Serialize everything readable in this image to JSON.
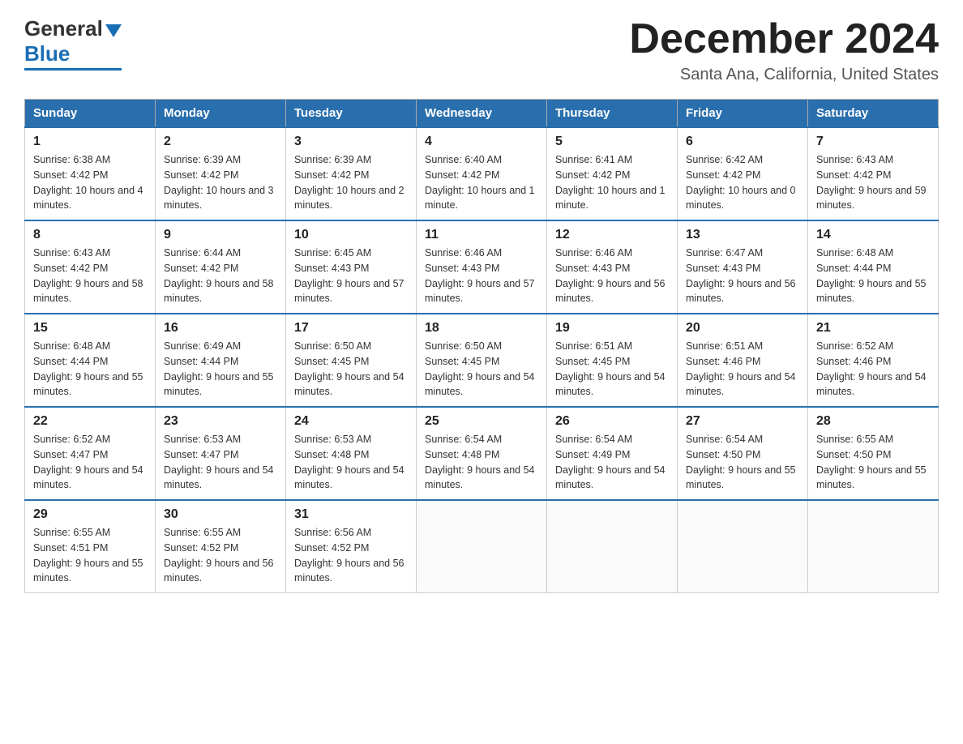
{
  "header": {
    "logo": {
      "text1": "General",
      "text2": "Blue"
    },
    "title": "December 2024",
    "location": "Santa Ana, California, United States"
  },
  "weekdays": [
    "Sunday",
    "Monday",
    "Tuesday",
    "Wednesday",
    "Thursday",
    "Friday",
    "Saturday"
  ],
  "weeks": [
    [
      {
        "day": "1",
        "sunrise": "6:38 AM",
        "sunset": "4:42 PM",
        "daylight": "10 hours and 4 minutes."
      },
      {
        "day": "2",
        "sunrise": "6:39 AM",
        "sunset": "4:42 PM",
        "daylight": "10 hours and 3 minutes."
      },
      {
        "day": "3",
        "sunrise": "6:39 AM",
        "sunset": "4:42 PM",
        "daylight": "10 hours and 2 minutes."
      },
      {
        "day": "4",
        "sunrise": "6:40 AM",
        "sunset": "4:42 PM",
        "daylight": "10 hours and 1 minute."
      },
      {
        "day": "5",
        "sunrise": "6:41 AM",
        "sunset": "4:42 PM",
        "daylight": "10 hours and 1 minute."
      },
      {
        "day": "6",
        "sunrise": "6:42 AM",
        "sunset": "4:42 PM",
        "daylight": "10 hours and 0 minutes."
      },
      {
        "day": "7",
        "sunrise": "6:43 AM",
        "sunset": "4:42 PM",
        "daylight": "9 hours and 59 minutes."
      }
    ],
    [
      {
        "day": "8",
        "sunrise": "6:43 AM",
        "sunset": "4:42 PM",
        "daylight": "9 hours and 58 minutes."
      },
      {
        "day": "9",
        "sunrise": "6:44 AM",
        "sunset": "4:42 PM",
        "daylight": "9 hours and 58 minutes."
      },
      {
        "day": "10",
        "sunrise": "6:45 AM",
        "sunset": "4:43 PM",
        "daylight": "9 hours and 57 minutes."
      },
      {
        "day": "11",
        "sunrise": "6:46 AM",
        "sunset": "4:43 PM",
        "daylight": "9 hours and 57 minutes."
      },
      {
        "day": "12",
        "sunrise": "6:46 AM",
        "sunset": "4:43 PM",
        "daylight": "9 hours and 56 minutes."
      },
      {
        "day": "13",
        "sunrise": "6:47 AM",
        "sunset": "4:43 PM",
        "daylight": "9 hours and 56 minutes."
      },
      {
        "day": "14",
        "sunrise": "6:48 AM",
        "sunset": "4:44 PM",
        "daylight": "9 hours and 55 minutes."
      }
    ],
    [
      {
        "day": "15",
        "sunrise": "6:48 AM",
        "sunset": "4:44 PM",
        "daylight": "9 hours and 55 minutes."
      },
      {
        "day": "16",
        "sunrise": "6:49 AM",
        "sunset": "4:44 PM",
        "daylight": "9 hours and 55 minutes."
      },
      {
        "day": "17",
        "sunrise": "6:50 AM",
        "sunset": "4:45 PM",
        "daylight": "9 hours and 54 minutes."
      },
      {
        "day": "18",
        "sunrise": "6:50 AM",
        "sunset": "4:45 PM",
        "daylight": "9 hours and 54 minutes."
      },
      {
        "day": "19",
        "sunrise": "6:51 AM",
        "sunset": "4:45 PM",
        "daylight": "9 hours and 54 minutes."
      },
      {
        "day": "20",
        "sunrise": "6:51 AM",
        "sunset": "4:46 PM",
        "daylight": "9 hours and 54 minutes."
      },
      {
        "day": "21",
        "sunrise": "6:52 AM",
        "sunset": "4:46 PM",
        "daylight": "9 hours and 54 minutes."
      }
    ],
    [
      {
        "day": "22",
        "sunrise": "6:52 AM",
        "sunset": "4:47 PM",
        "daylight": "9 hours and 54 minutes."
      },
      {
        "day": "23",
        "sunrise": "6:53 AM",
        "sunset": "4:47 PM",
        "daylight": "9 hours and 54 minutes."
      },
      {
        "day": "24",
        "sunrise": "6:53 AM",
        "sunset": "4:48 PM",
        "daylight": "9 hours and 54 minutes."
      },
      {
        "day": "25",
        "sunrise": "6:54 AM",
        "sunset": "4:48 PM",
        "daylight": "9 hours and 54 minutes."
      },
      {
        "day": "26",
        "sunrise": "6:54 AM",
        "sunset": "4:49 PM",
        "daylight": "9 hours and 54 minutes."
      },
      {
        "day": "27",
        "sunrise": "6:54 AM",
        "sunset": "4:50 PM",
        "daylight": "9 hours and 55 minutes."
      },
      {
        "day": "28",
        "sunrise": "6:55 AM",
        "sunset": "4:50 PM",
        "daylight": "9 hours and 55 minutes."
      }
    ],
    [
      {
        "day": "29",
        "sunrise": "6:55 AM",
        "sunset": "4:51 PM",
        "daylight": "9 hours and 55 minutes."
      },
      {
        "day": "30",
        "sunrise": "6:55 AM",
        "sunset": "4:52 PM",
        "daylight": "9 hours and 56 minutes."
      },
      {
        "day": "31",
        "sunrise": "6:56 AM",
        "sunset": "4:52 PM",
        "daylight": "9 hours and 56 minutes."
      },
      null,
      null,
      null,
      null
    ]
  ]
}
